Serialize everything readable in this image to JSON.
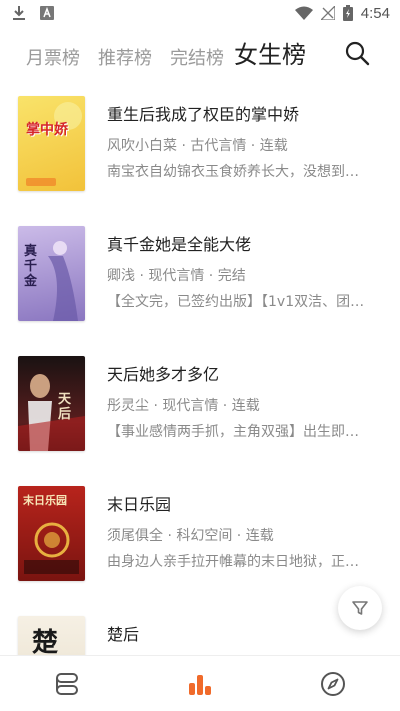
{
  "status_bar": {
    "time": "4:54",
    "icons": [
      "download-icon",
      "font-icon",
      "wifi-icon",
      "no-signal-icon",
      "battery-charging-icon"
    ]
  },
  "tabs": [
    {
      "label": "月票榜",
      "active": false
    },
    {
      "label": "推荐榜",
      "active": false
    },
    {
      "label": "完结榜",
      "active": false
    },
    {
      "label": "女生榜",
      "active": true
    }
  ],
  "books": [
    {
      "title": "重生后我成了权臣的掌中娇",
      "author": "风吹小白菜",
      "category": "古代言情",
      "status": "连载",
      "desc": "南宝衣自幼锦衣玉食娇养长大，没想到…",
      "cover_text": "掌中娇",
      "cover_colors": [
        "#f7d84a",
        "#f2c23a"
      ]
    },
    {
      "title": "真千金她是全能大佬",
      "author": "卿浅",
      "category": "现代言情",
      "status": "完结",
      "desc": "【全文完，已签约出版】【1v1双洁、团…",
      "cover_text": "真千金",
      "cover_colors": [
        "#9b86c9",
        "#c9b8e6"
      ]
    },
    {
      "title": "天后她多才多亿",
      "author": "彤灵尘",
      "category": "现代言情",
      "status": "连载",
      "desc": "【事业感情两手抓，主角双强】出生即…",
      "cover_text": "天后",
      "cover_colors": [
        "#2a1a1a",
        "#8a2a2a"
      ]
    },
    {
      "title": "末日乐园",
      "author": "须尾俱全",
      "category": "科幻空间",
      "status": "连载",
      "desc": "由身边人亲手拉开帷幕的末日地狱，正…",
      "cover_text": "末日乐园",
      "cover_colors": [
        "#a8201a",
        "#e0b040"
      ]
    },
    {
      "title": "楚后",
      "author": "",
      "category": "",
      "status": "",
      "desc": "",
      "cover_text": "楚",
      "cover_colors": [
        "#f3ece0",
        "#e6dccb"
      ]
    }
  ],
  "meta_separator": " · ",
  "bottom_nav": [
    {
      "icon": "bookshelf-icon",
      "active": false
    },
    {
      "icon": "ranking-icon",
      "active": true
    },
    {
      "icon": "compass-icon",
      "active": false
    }
  ],
  "colors": {
    "accent": "#f06a2a",
    "text": "#222222",
    "muted": "#8a8a8a"
  }
}
